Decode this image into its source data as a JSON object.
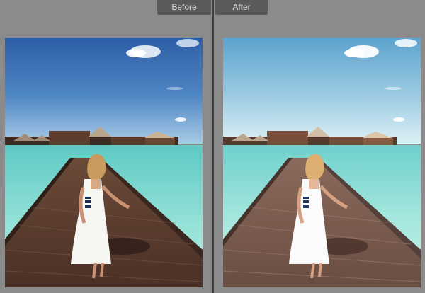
{
  "compare": {
    "before_label": "Before",
    "after_label": "After"
  },
  "colors": {
    "background": "#8b8b8b",
    "tab": "#5a5a5a",
    "divider": "#3f3f3f",
    "before_sky_top": "#2f63a8",
    "before_sky_bottom": "#9cc3e6",
    "after_sky_top": "#5fa6cf",
    "after_sky_bottom": "#d8edf4"
  },
  "photo": {
    "subject": "woman-in-white-dress-on-boardwalk",
    "scene": "overwater-bungalows-lagoon"
  }
}
